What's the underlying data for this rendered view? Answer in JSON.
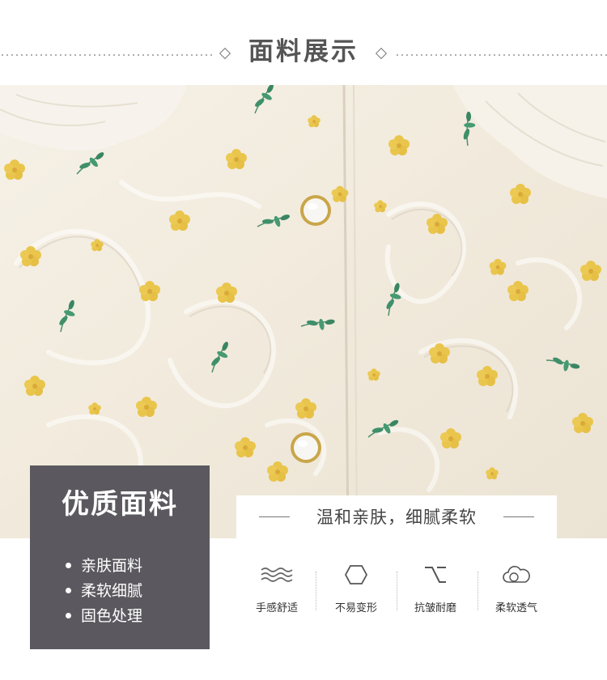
{
  "header": {
    "title": "面料展示"
  },
  "quality_box": {
    "title": "优质面料",
    "items": [
      {
        "label": "亲肤面料"
      },
      {
        "label": "柔软细腻"
      },
      {
        "label": "固色处理"
      }
    ]
  },
  "tagline": "温和亲肤，细腻柔软",
  "features": [
    {
      "label": "手感舒适",
      "icon": "waves-icon"
    },
    {
      "label": "不易变形",
      "icon": "hexagon-icon"
    },
    {
      "label": "抗皱耐磨",
      "icon": "switch-icon"
    },
    {
      "label": "柔软透气",
      "icon": "cloud-icon"
    }
  ],
  "colors": {
    "fabric": "#f3ede2",
    "flower_yellow": "#e8c24a",
    "leaf_green": "#3f8f6a",
    "dark_box": "#5b595f"
  }
}
